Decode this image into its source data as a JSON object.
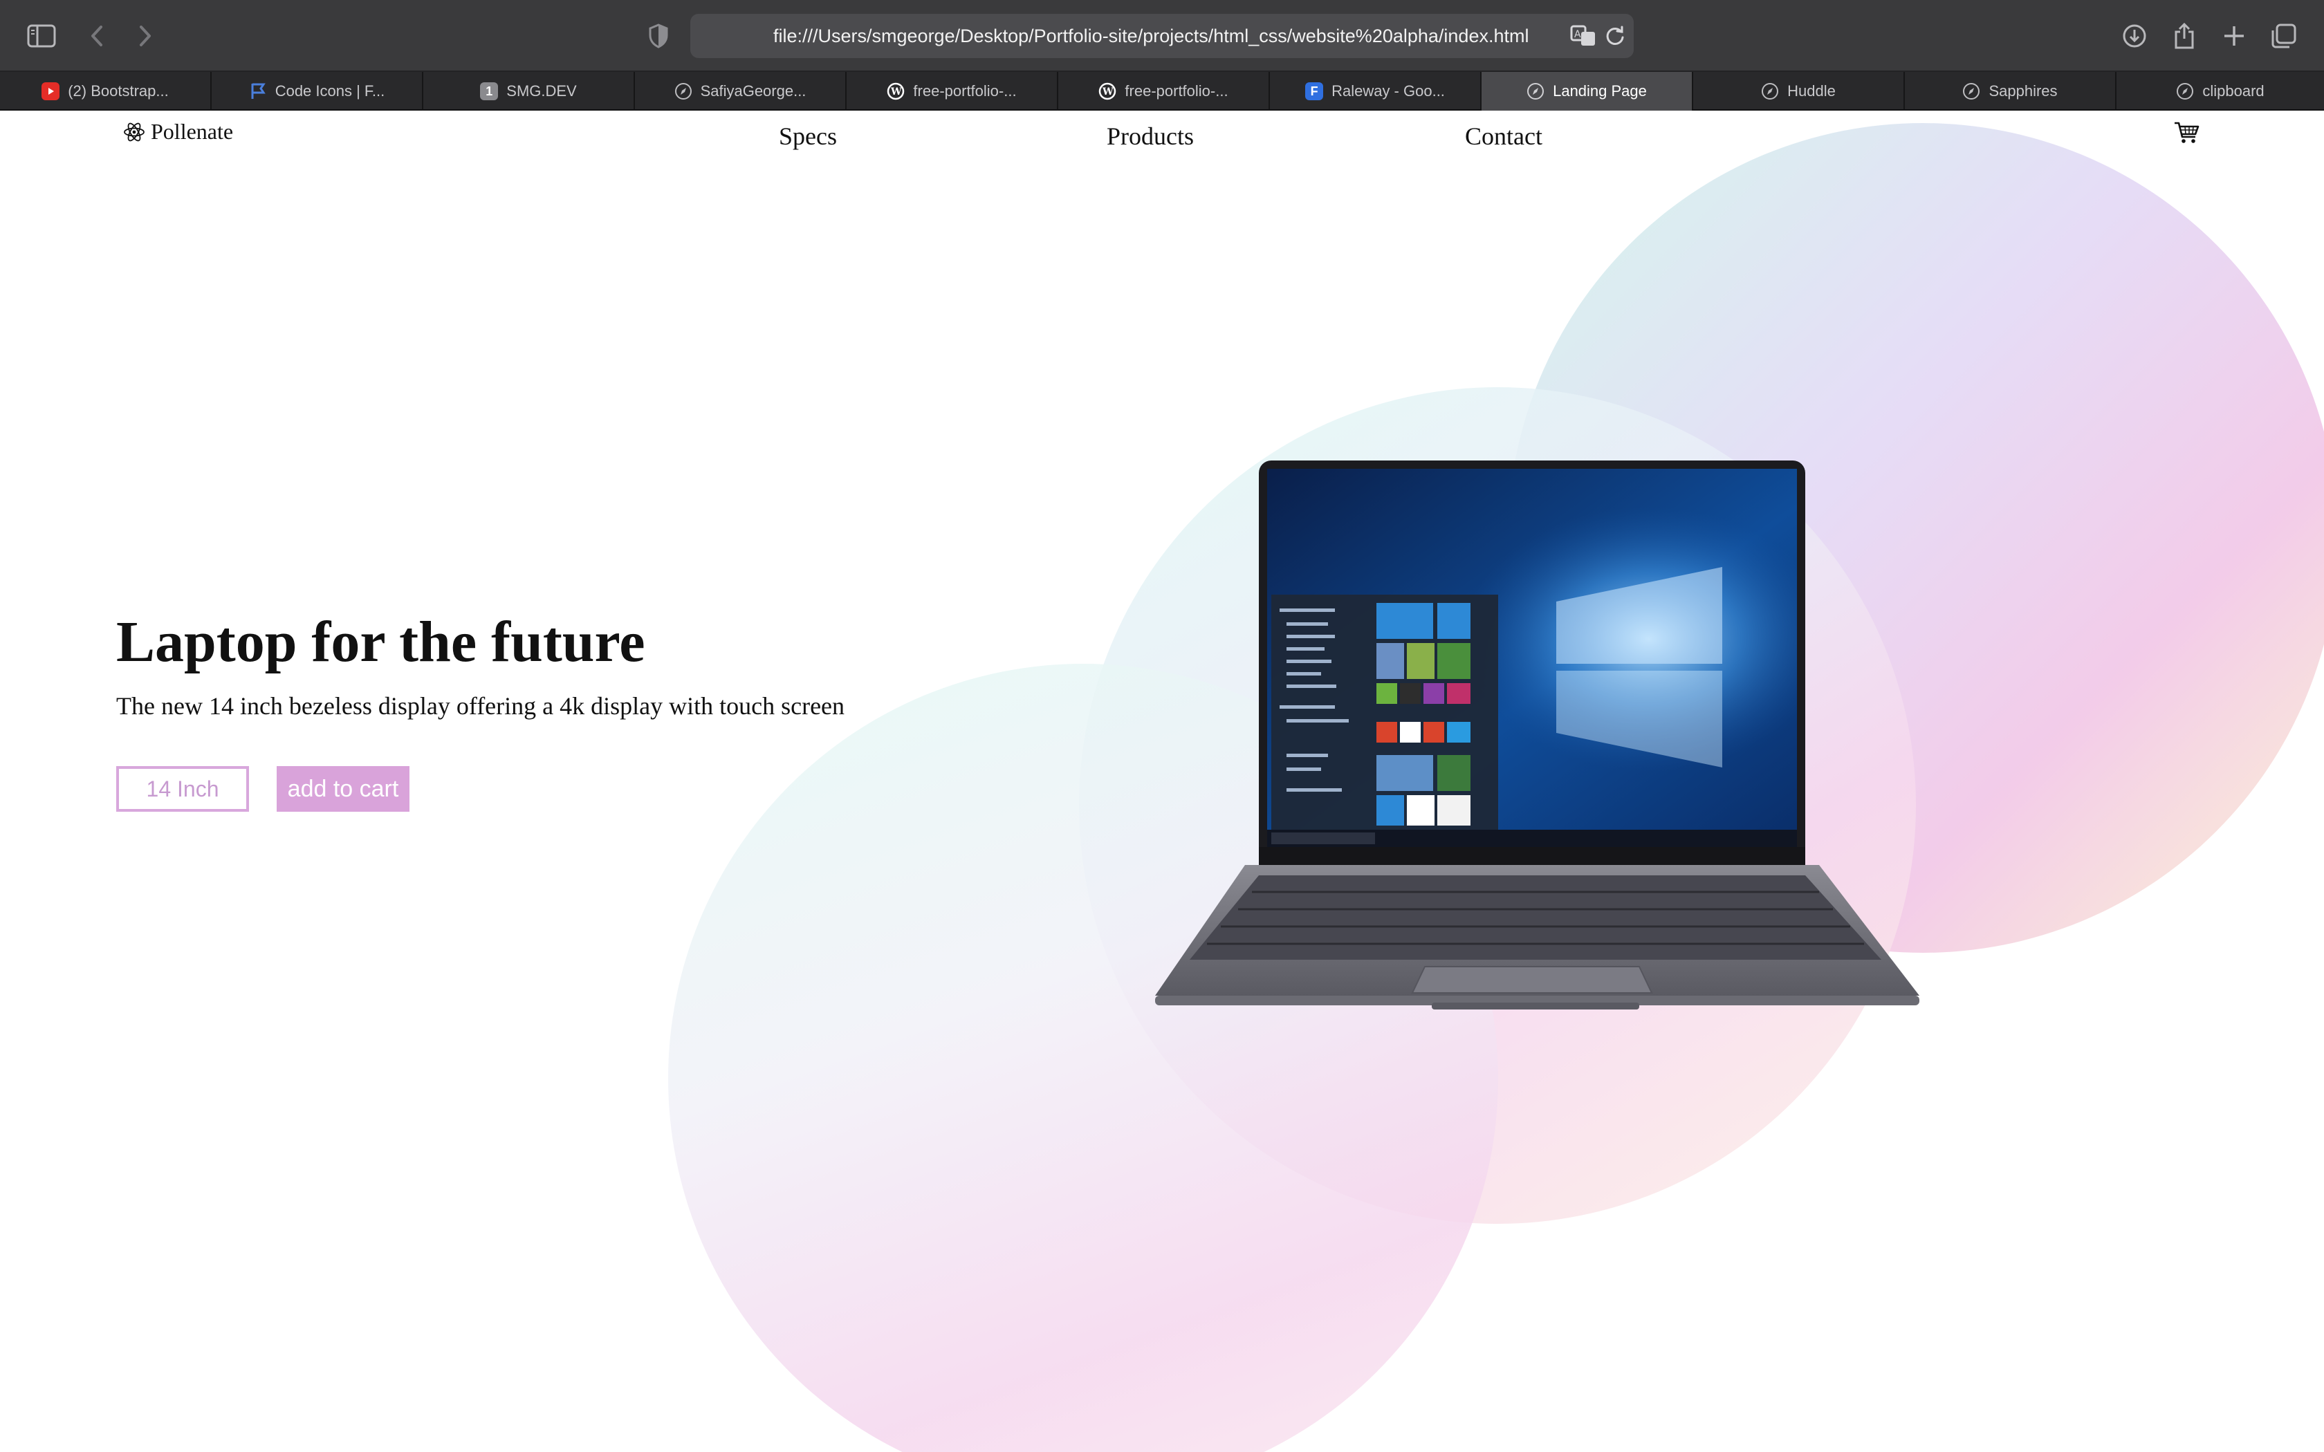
{
  "browser": {
    "url": "file:///Users/smgeorge/Desktop/Portfolio-site/projects/html_css/website%20alpha/index.html",
    "tabs": [
      {
        "label": "(2) Bootstrap...",
        "icon": "youtube-icon",
        "color": "#e52d27"
      },
      {
        "label": "Code Icons | F...",
        "icon": "flag-icon",
        "color": "#4a7fdc"
      },
      {
        "label": "SMG.DEV",
        "icon": "number-one-icon",
        "color": "#8a8a8e",
        "glyph": "1"
      },
      {
        "label": "SafiyaGeorge...",
        "icon": "compass-icon",
        "color": "#bdbdc0"
      },
      {
        "label": "free-portfolio-...",
        "icon": "wordpress-icon",
        "color": "#ffffff"
      },
      {
        "label": "free-portfolio-...",
        "icon": "wordpress-icon",
        "color": "#ffffff"
      },
      {
        "label": "Raleway - Goo...",
        "icon": "f-icon",
        "color": "#2f6fe0",
        "glyph": "F"
      },
      {
        "label": "Landing Page",
        "icon": "compass-icon",
        "color": "#bdbdc0",
        "active": true
      },
      {
        "label": "Huddle",
        "icon": "compass-icon",
        "color": "#bdbdc0"
      },
      {
        "label": "Sapphires",
        "icon": "compass-icon",
        "color": "#bdbdc0"
      },
      {
        "label": "clipboard",
        "icon": "compass-icon",
        "color": "#bdbdc0"
      }
    ]
  },
  "site": {
    "brand": "Pollenate",
    "nav": [
      "Specs",
      "Products",
      "Contact"
    ],
    "cart_icon": "cart-icon"
  },
  "hero": {
    "title": "Laptop for the future",
    "subtitle": "The new 14 inch bezeless display offering a 4k display with touch screen",
    "size_button": "14 Inch",
    "cart_button": "add to cart",
    "accent_color": "#d9a3da",
    "image": "laptop-product-image"
  }
}
